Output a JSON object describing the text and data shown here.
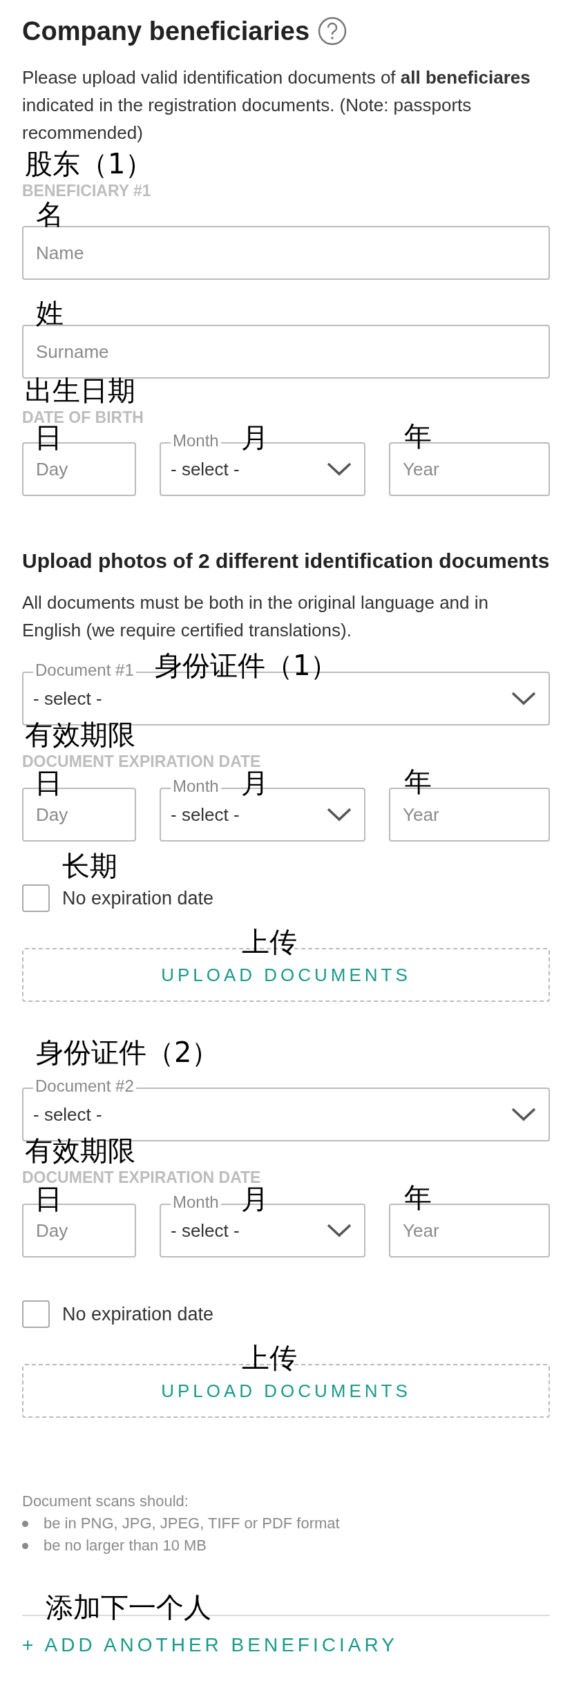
{
  "title": "Company beneficiaries",
  "intro": "Please upload valid identification documents of **all beneficiares** indicated in the registration documents. (Note: passports recommended)",
  "beneficiary": {
    "annotation": "股东（1）",
    "label": "BENEFICIARY #1",
    "fields": [
      {
        "annotation": "名",
        "placeholder": "Name"
      },
      {
        "annotation": "姓",
        "placeholder": "Surname"
      }
    ],
    "birth": {
      "annotation": "出生日期",
      "label": "DATE OF BIRTH",
      "day": {
        "annotation": "日",
        "placeholder": "Day"
      },
      "month": {
        "annotation": "月",
        "label": "Month",
        "value": "- select -"
      },
      "year": {
        "annotation": "年",
        "placeholder": "Year"
      }
    }
  },
  "upload_heading": "Upload photos of 2 different identification documents",
  "upload_note": "All documents must be both in the original language and in English (we require certified translations).",
  "documents": [
    {
      "annotation": "身份证件（1）",
      "label": "Document #1",
      "value": "- select -",
      "expiration": {
        "annotation": "有效期限",
        "label": "DOCUMENT EXPIRATION DATE",
        "day": {
          "annotation": "日",
          "placeholder": "Day"
        },
        "month": {
          "annotation": "月",
          "label": "Month",
          "value": "- select -"
        },
        "year": {
          "annotation": "年",
          "placeholder": "Year"
        }
      },
      "no_expiration": {
        "annotation": "长期",
        "label": "No expiration date",
        "checked": false
      },
      "upload": {
        "annotation": "上传",
        "label": "UPLOAD DOCUMENTS"
      }
    },
    {
      "annotation": "身份证件（2）",
      "label": "Document #2",
      "value": "- select -",
      "expiration": {
        "annotation": "有效期限",
        "label": "DOCUMENT EXPIRATION DATE",
        "day": {
          "annotation": "日",
          "placeholder": "Day"
        },
        "month": {
          "annotation": "月",
          "label": "Month",
          "value": "- select -"
        },
        "year": {
          "annotation": "年",
          "placeholder": "Year"
        }
      },
      "no_expiration": {
        "label": "No expiration date",
        "checked": false
      },
      "upload": {
        "annotation": "上传",
        "label": "UPLOAD DOCUMENTS"
      }
    }
  ],
  "scan_rules": {
    "heading": "Document scans should:",
    "items": [
      "be in PNG, JPG, JPEG, TIFF or PDF format",
      "be no larger than 10 MB"
    ]
  },
  "add": {
    "annotation": "添加下一个人",
    "label": "+ ADD ANOTHER BENEFICIARY"
  }
}
